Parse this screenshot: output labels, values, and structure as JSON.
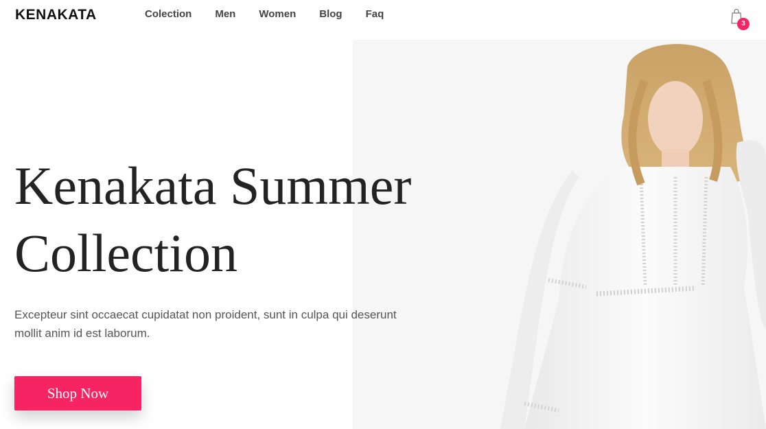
{
  "header": {
    "brand": "KENAKATA",
    "nav": [
      {
        "label": "Colection"
      },
      {
        "label": "Men"
      },
      {
        "label": "Women"
      },
      {
        "label": "Blog"
      },
      {
        "label": "Faq"
      }
    ],
    "cart": {
      "icon": "shopping-bag-icon",
      "count": "3",
      "badge_color": "#f72463"
    }
  },
  "hero": {
    "title_line1": "Kenakata Summer",
    "title_line2": "Collection",
    "description_line1": "Excepteur sint occaecat cupidatat non proident, sunt in culpa qui deserunt",
    "description_line2": "mollit anim id est laborum.",
    "cta_label": "Shop Now",
    "cta_color": "#f72463",
    "image": "model-in-white-summer-dress"
  }
}
